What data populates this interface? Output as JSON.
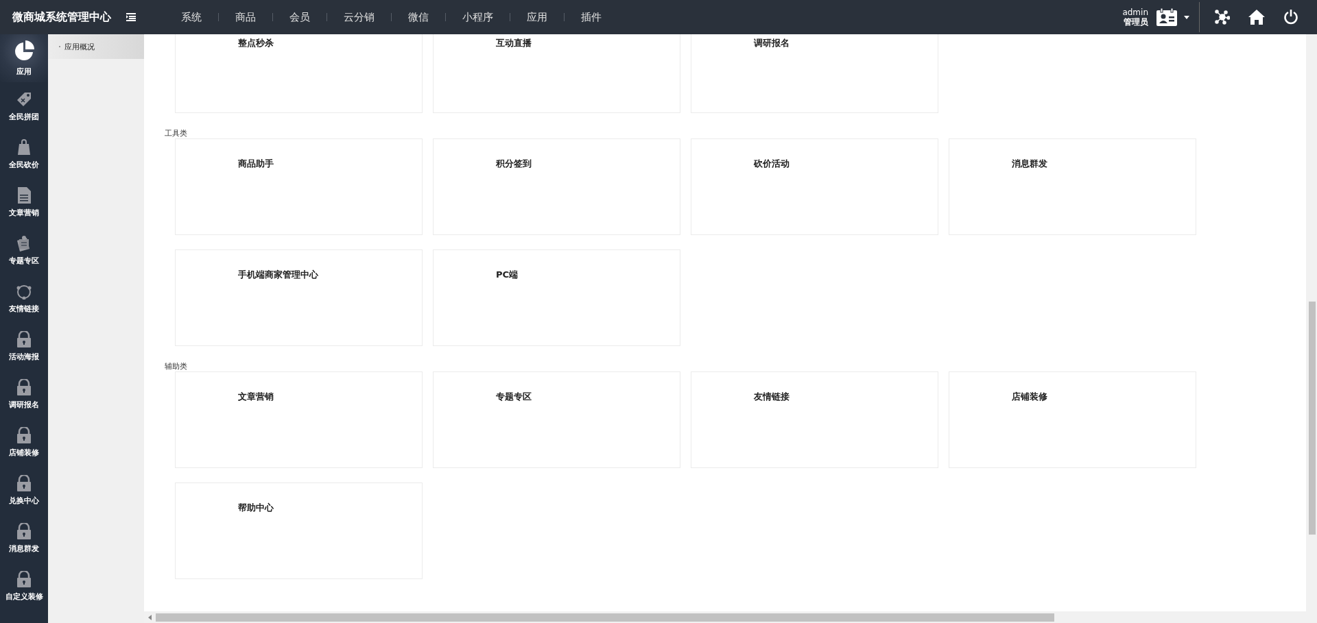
{
  "header": {
    "title": "微商城系统管理中心",
    "menu": [
      "系统",
      "商品",
      "会员",
      "云分销",
      "微信",
      "小程序",
      "应用",
      "插件"
    ],
    "user": {
      "name": "admin",
      "role": "管理员"
    }
  },
  "sidebar": {
    "items": [
      {
        "label": "应用",
        "selected": true,
        "locked": false
      },
      {
        "label": "全民拼团",
        "selected": false,
        "locked": false
      },
      {
        "label": "全民砍价",
        "selected": false,
        "locked": false
      },
      {
        "label": "文章营销",
        "selected": false,
        "locked": false
      },
      {
        "label": "专题专区",
        "selected": false,
        "locked": false
      },
      {
        "label": "友情链接",
        "selected": false,
        "locked": false
      },
      {
        "label": "活动海报",
        "selected": false,
        "locked": true
      },
      {
        "label": "调研报名",
        "selected": false,
        "locked": true
      },
      {
        "label": "店铺装修",
        "selected": false,
        "locked": true
      },
      {
        "label": "兑换中心",
        "selected": false,
        "locked": true
      },
      {
        "label": "消息群发",
        "selected": false,
        "locked": true
      },
      {
        "label": "自定义装修",
        "selected": false,
        "locked": true
      }
    ]
  },
  "subnav": {
    "items": [
      {
        "label": "应用概况",
        "selected": true
      }
    ]
  },
  "sections": [
    {
      "cards": [
        "整点秒杀",
        "互动直播",
        "调研报名"
      ]
    },
    {
      "title": "工具类",
      "cards": [
        "商品助手",
        "积分签到",
        "砍价活动",
        "消息群发",
        "手机端商家管理中心",
        "PC端"
      ]
    },
    {
      "title": "辅助类",
      "cards": [
        "文章营销",
        "专题专区",
        "友情链接",
        "店铺装修",
        "帮助中心"
      ]
    }
  ]
}
